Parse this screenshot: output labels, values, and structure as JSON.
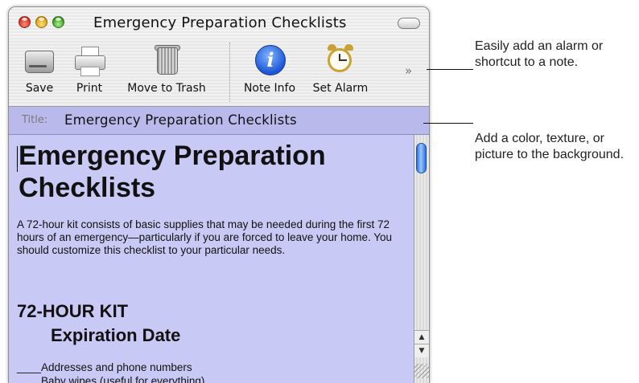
{
  "window": {
    "title": "Emergency Preparation Checklists"
  },
  "toolbar": {
    "items": [
      {
        "label": "Save",
        "icon": "disk-icon"
      },
      {
        "label": "Print",
        "icon": "printer-icon"
      },
      {
        "label": "Move to Trash",
        "icon": "trash-icon"
      },
      {
        "label": "Note Info",
        "icon": "info-icon"
      },
      {
        "label": "Set Alarm",
        "icon": "alarm-clock-icon"
      }
    ],
    "overflow": "»"
  },
  "title_field": {
    "label": "Title:",
    "value": "Emergency Preparation Checklists"
  },
  "note": {
    "heading": "Emergency Preparation Checklists",
    "intro": "A 72-hour kit consists of basic supplies that may be needed during the first 72 hours of an emergency—particularly if you are forced to leave your home. You should customize this checklist to your particular needs.",
    "section_heading": "72-HOUR KIT",
    "subheading": "Expiration Date",
    "items": [
      "____Addresses and phone numbers",
      "____Baby wipes (useful for everything)"
    ]
  },
  "callouts": {
    "alarm": [
      "Easily add an alarm or",
      "shortcut to a note."
    ],
    "background": [
      "Add a color, texture, or",
      "picture to the background."
    ]
  },
  "colors": {
    "note_background": "#c9c9f6",
    "title_field_background": "#b9b9ec"
  }
}
